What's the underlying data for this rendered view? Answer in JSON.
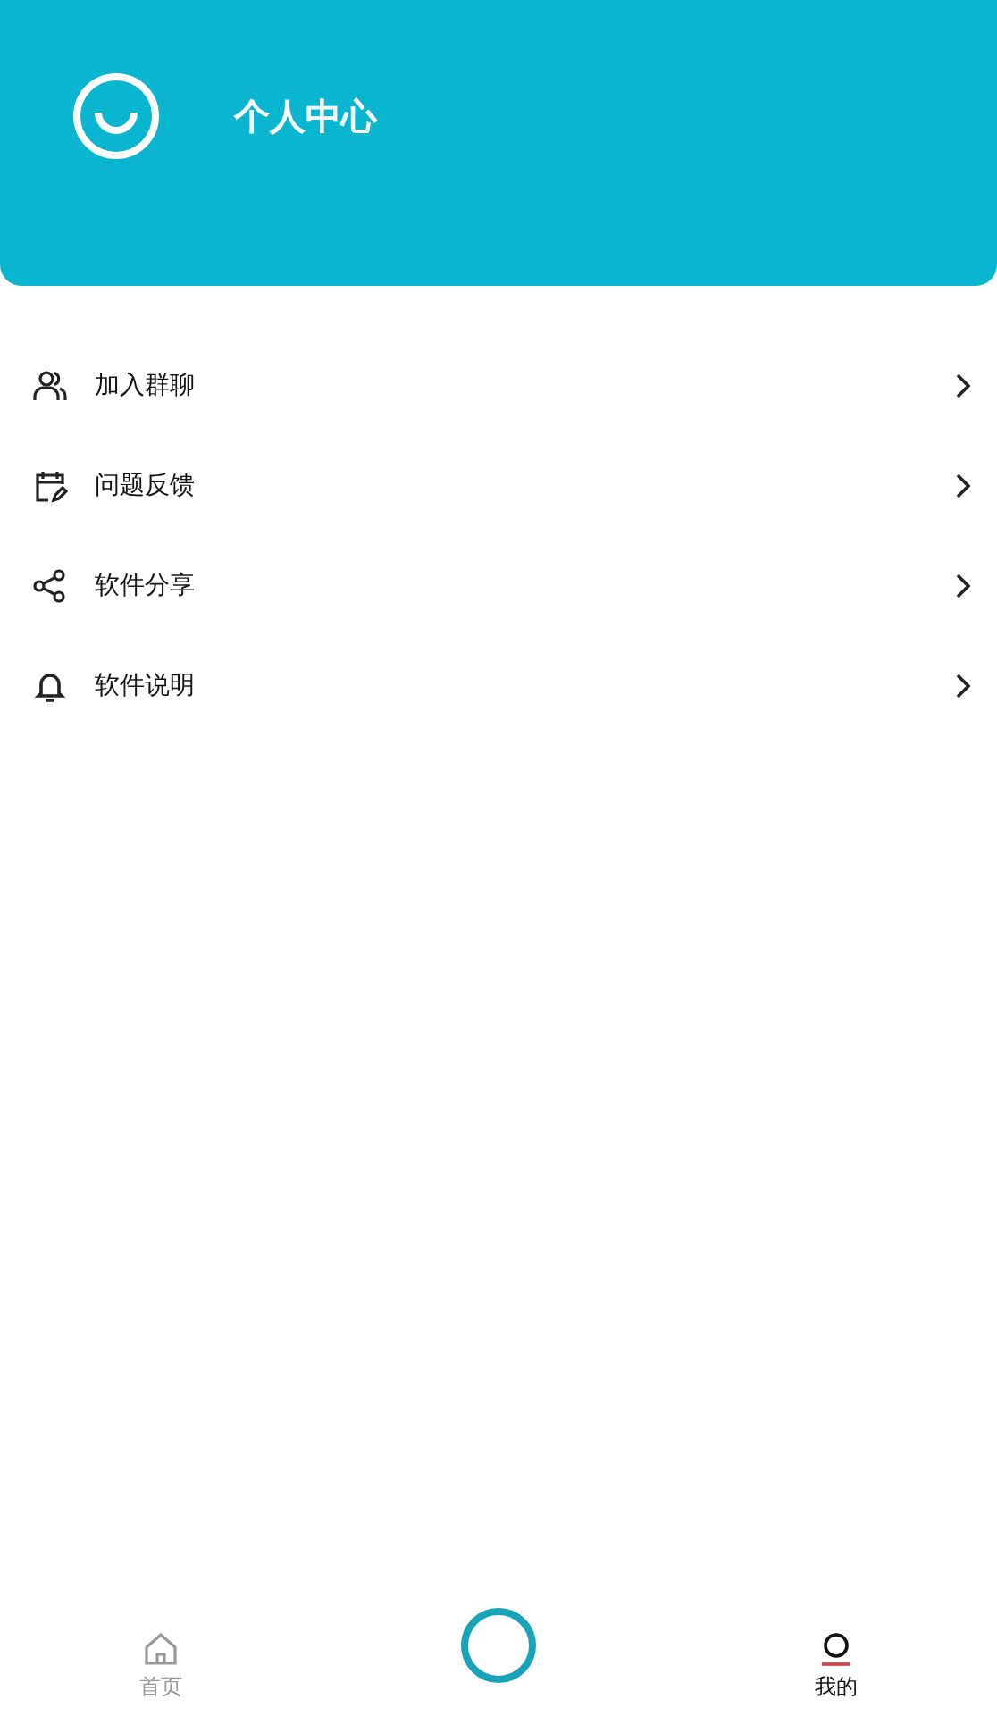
{
  "header": {
    "title": "个人中心"
  },
  "menu": [
    {
      "kind": "group",
      "label": "加入群聊"
    },
    {
      "kind": "feedback",
      "label": "问题反馈"
    },
    {
      "kind": "share",
      "label": "软件分享"
    },
    {
      "kind": "bell",
      "label": "软件说明"
    }
  ],
  "tabs": [
    {
      "kind": "home",
      "label": "首页",
      "selected": false
    },
    {
      "kind": "center"
    },
    {
      "kind": "me",
      "label": "我的",
      "selected": true
    }
  ]
}
